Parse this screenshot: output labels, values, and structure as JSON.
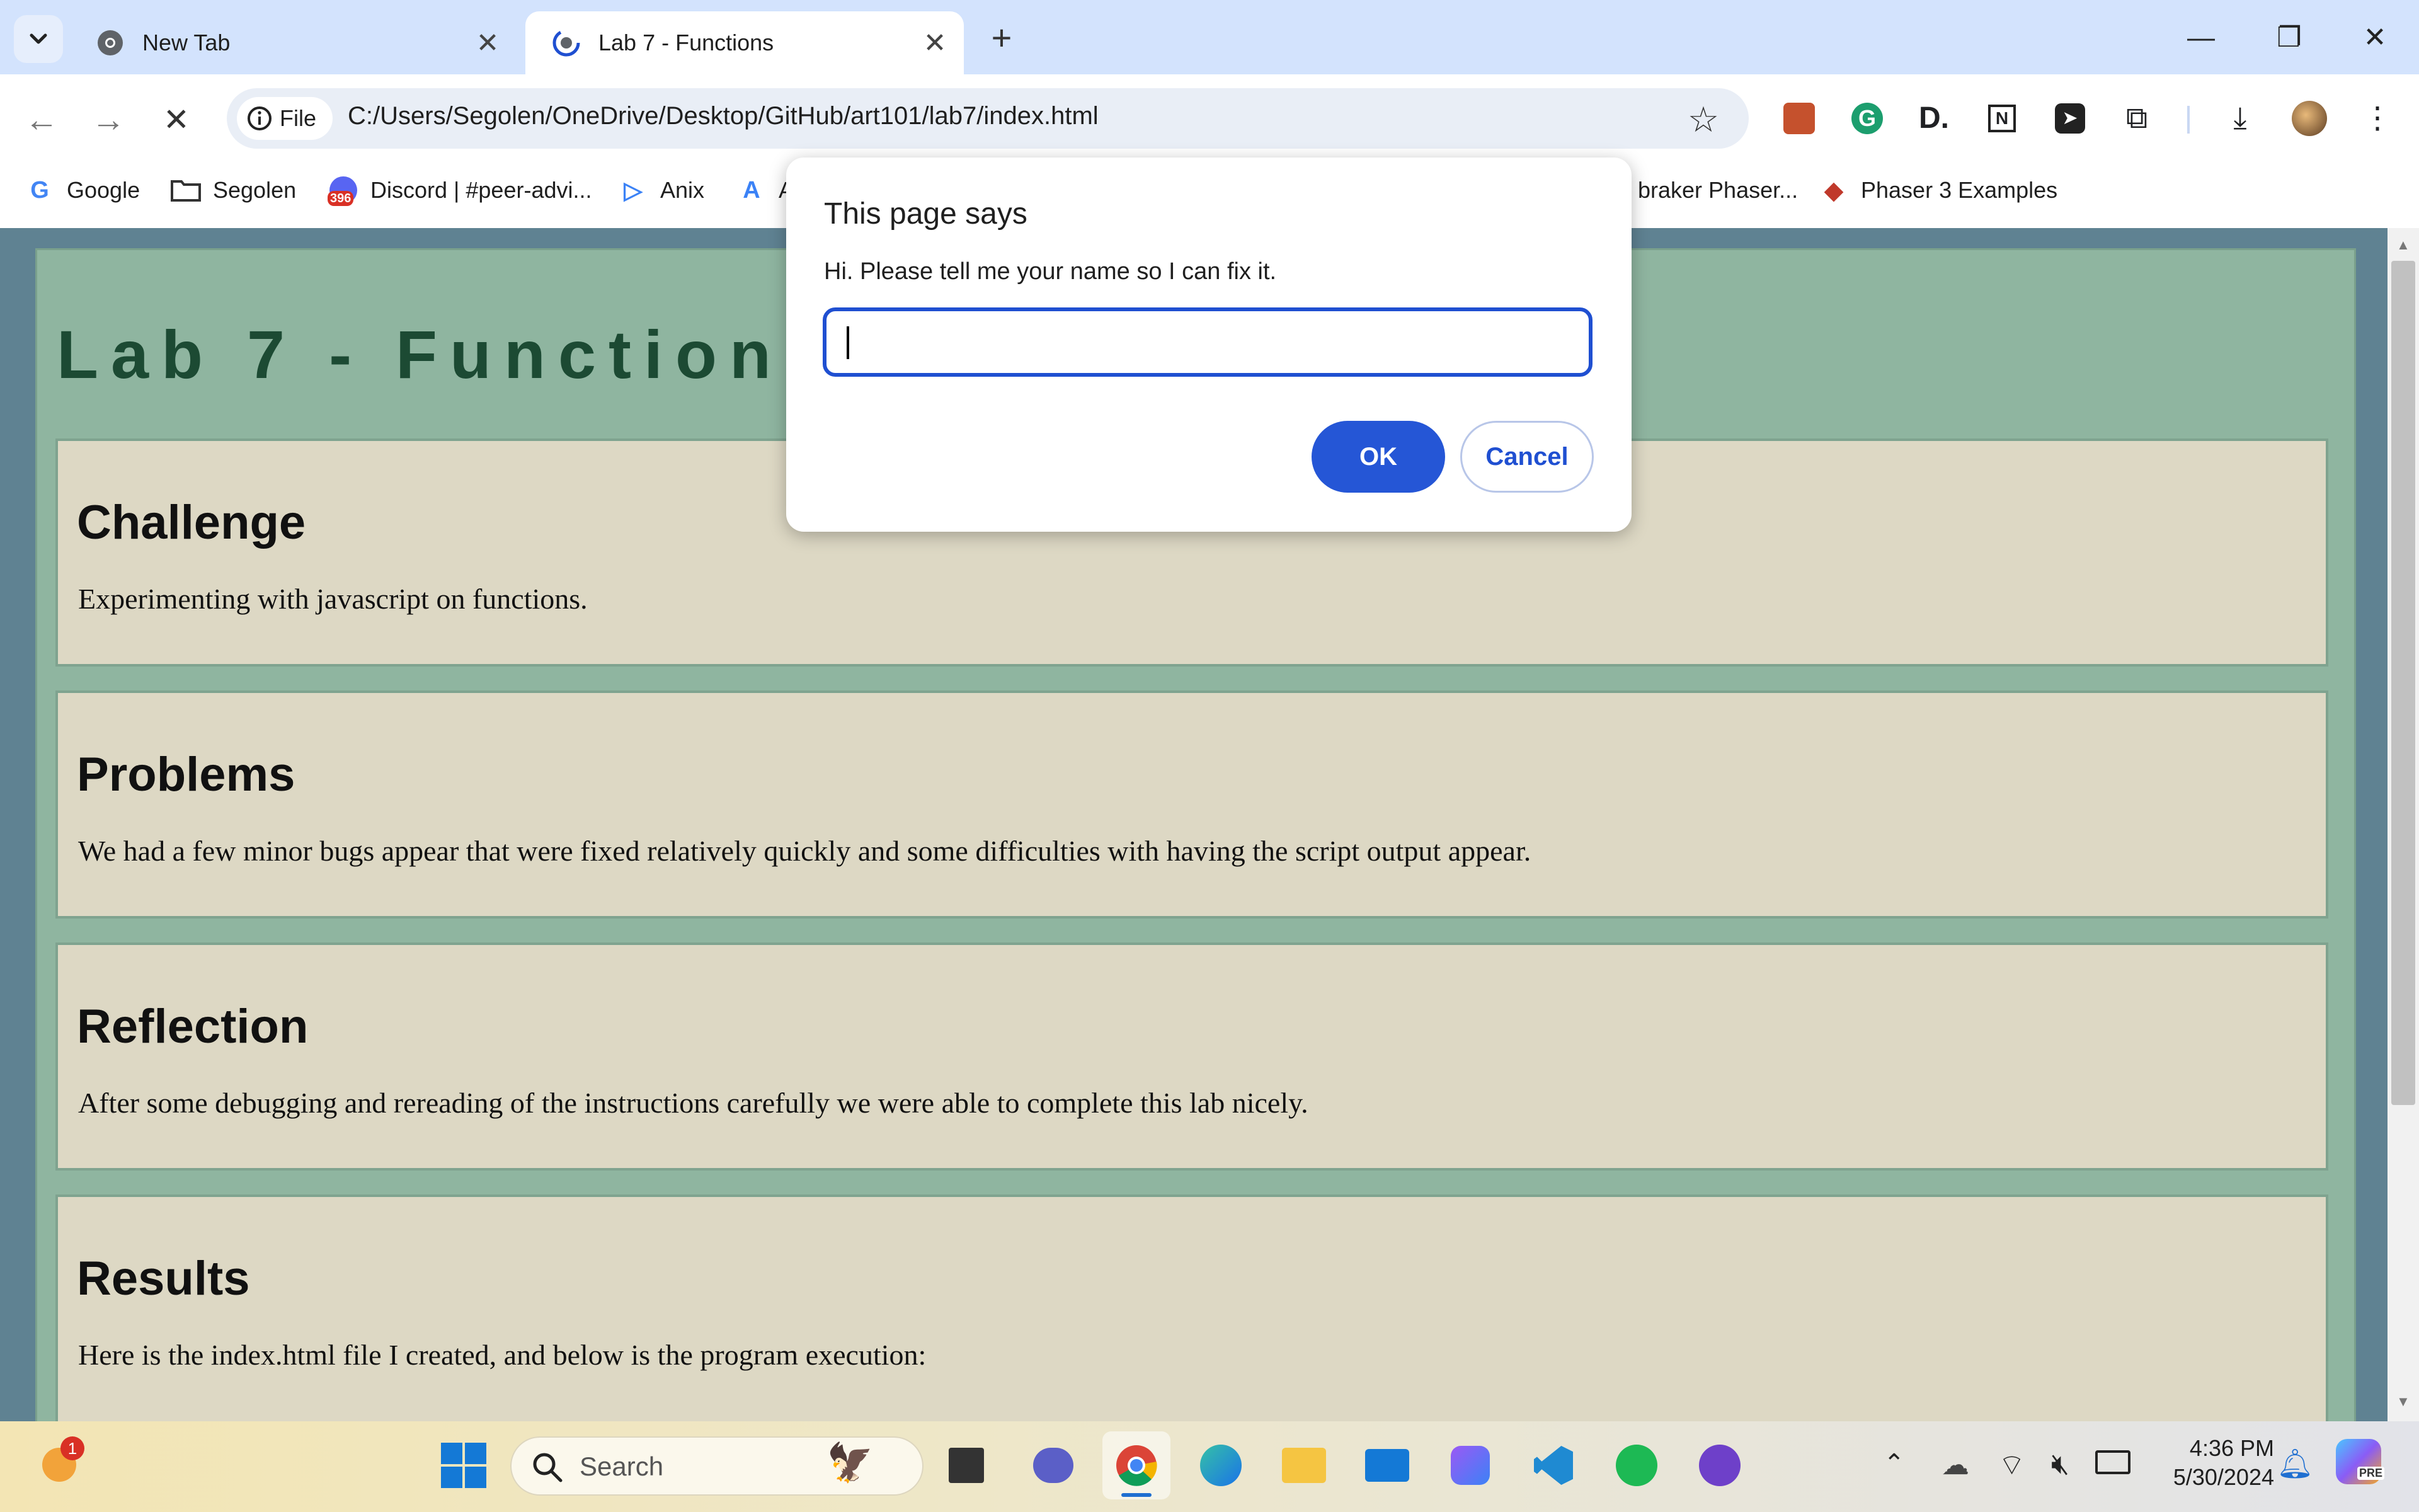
{
  "browser": {
    "tabs": [
      {
        "title": "New Tab",
        "active": false
      },
      {
        "title": "Lab 7 - Functions",
        "active": true
      }
    ],
    "address": {
      "scheme_chip": "File",
      "url": "C:/Users/Segolen/OneDrive/Desktop/GitHub/art101/lab7/index.html"
    },
    "bookmarks": [
      {
        "label": "Google"
      },
      {
        "label": "Segolen"
      },
      {
        "label": "Discord | #peer-advi...",
        "badge": "396"
      },
      {
        "label": "Anix"
      },
      {
        "label": "A"
      },
      {
        "label": "braker Phaser..."
      },
      {
        "label": "Phaser 3 Examples"
      }
    ]
  },
  "page": {
    "title": "Lab 7 - Functions",
    "sections": [
      {
        "heading": "Challenge",
        "text": "Experimenting with javascript on functions."
      },
      {
        "heading": "Problems",
        "text": "We had a few minor bugs appear that were fixed relatively quickly and some difficulties with having the script output appear."
      },
      {
        "heading": "Reflection",
        "text": "After some debugging and rereading of the instructions carefully we were able to complete this lab nicely."
      },
      {
        "heading": "Results",
        "text": "Here is the index.html file I created, and below is the program execution:"
      }
    ]
  },
  "dialog": {
    "title": "This page says",
    "message": "Hi. Please tell me your name so I can fix it.",
    "input_value": "",
    "ok_label": "OK",
    "cancel_label": "Cancel"
  },
  "taskbar": {
    "weather_badge": "1",
    "search_label": "Search",
    "time": "4:36 PM",
    "date": "5/30/2024",
    "copilot_badge": "PRE"
  },
  "colors": {
    "tabstrip": "#d3e3fd",
    "page_bg": "#5f8292",
    "container_bg": "#8fb5a0",
    "section_bg": "#ddd8c4",
    "title_color": "#1c4a33",
    "accent": "#2556d6"
  }
}
